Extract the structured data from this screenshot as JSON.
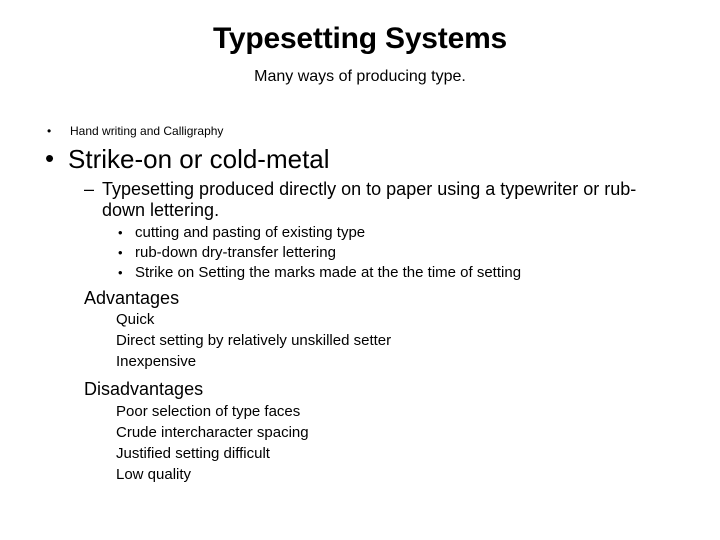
{
  "slide": {
    "title": "Typesetting Systems",
    "subtitle": "Many ways of producing type.",
    "background_color": "#ffffff",
    "text_color": "#000000",
    "bullet_glyph": "•",
    "dash_glyph": "–",
    "outline": {
      "level1_small": "Hand writing and Calligraphy",
      "level1_big": "Strike-on or cold-metal",
      "level2": "Typesetting produced directly on to paper using a typewriter or rub-down lettering.",
      "level3": [
        "cutting and pasting of existing type",
        "rub-down dry-transfer lettering",
        "Strike on Setting the marks made at the the time of setting"
      ],
      "advantages": {
        "heading": "Advantages",
        "items": [
          "Quick",
          "Direct setting by relatively unskilled setter",
          "Inexpensive"
        ]
      },
      "disadvantages": {
        "heading": "Disadvantages",
        "items": [
          "Poor selection of type faces",
          "Crude intercharacter spacing",
          "Justified setting difficult",
          "Low quality"
        ]
      }
    }
  }
}
